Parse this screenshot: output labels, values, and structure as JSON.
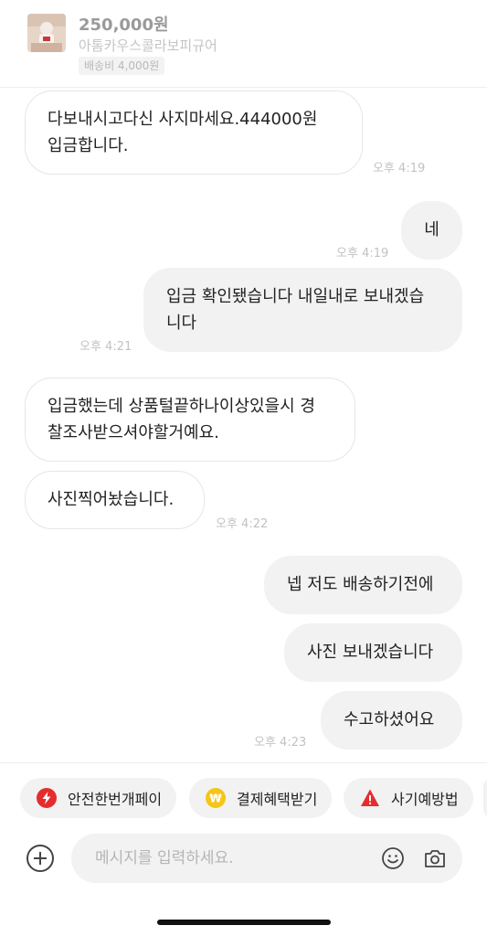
{
  "product": {
    "price": "250,000원",
    "name": "아톰카우스콜라보피규어",
    "shipping": "배송비 4,000원",
    "thumbnail_icon": "product-thumbnail"
  },
  "messages": [
    {
      "side": "received",
      "lines": [
        "다보내시고다신 사지마세요.444000원",
        "입금합니다."
      ],
      "time": "오후 4:19"
    },
    {
      "side": "sent",
      "lines": [
        "네"
      ],
      "time": "오후 4:19"
    },
    {
      "side": "sent",
      "lines": [
        "입금 확인됐습니다 내일내로 보내겠습",
        "니다"
      ],
      "time": "오후 4:21"
    },
    {
      "side": "received",
      "lines": [
        "입금했는데 상품털끝하나이상있을시 경",
        "찰조사받으셔야할거예요."
      ],
      "time": ""
    },
    {
      "side": "received",
      "lines": [
        "사진찍어놨습니다."
      ],
      "time": "오후 4:22"
    },
    {
      "side": "sent",
      "lines": [
        "넵 저도 배송하기전에"
      ],
      "time": ""
    },
    {
      "side": "sent",
      "lines": [
        "사진 보내겠습니다"
      ],
      "time": ""
    },
    {
      "side": "sent",
      "lines": [
        "수고하셨어요"
      ],
      "time": "오후 4:23"
    }
  ],
  "quick_actions": [
    {
      "label": "안전한번개페이",
      "icon": "lightning-icon",
      "color": "#e52d2d"
    },
    {
      "label": "결제혜택받기",
      "icon": "won-coin-icon",
      "color": "#f5c518"
    },
    {
      "label": "사기예방법",
      "icon": "warning-icon",
      "color": "#e52d2d"
    }
  ],
  "composer": {
    "placeholder": "메시지를 입력하세요.",
    "value": ""
  },
  "icons": {
    "plus": "plus-circle-icon",
    "emoji": "smiley-icon",
    "camera": "camera-icon"
  }
}
